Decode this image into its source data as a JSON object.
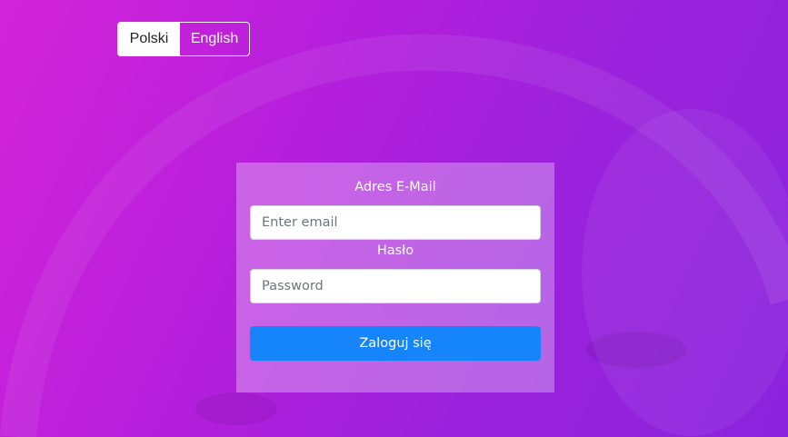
{
  "language_switch": {
    "options": [
      {
        "label": "Polski",
        "active": true
      },
      {
        "label": "English",
        "active": false
      }
    ]
  },
  "login_form": {
    "email_label": "Adres E-Mail",
    "email_placeholder": "Enter email",
    "email_value": "",
    "password_label": "Hasło",
    "password_placeholder": "Password",
    "password_value": "",
    "submit_label": "Zaloguj się"
  },
  "colors": {
    "background_gradient_start": "#d324d8",
    "background_gradient_end": "#8a23dd",
    "primary_button": "#1685fb",
    "card_overlay": "rgba(255,255,255,0.30)"
  }
}
